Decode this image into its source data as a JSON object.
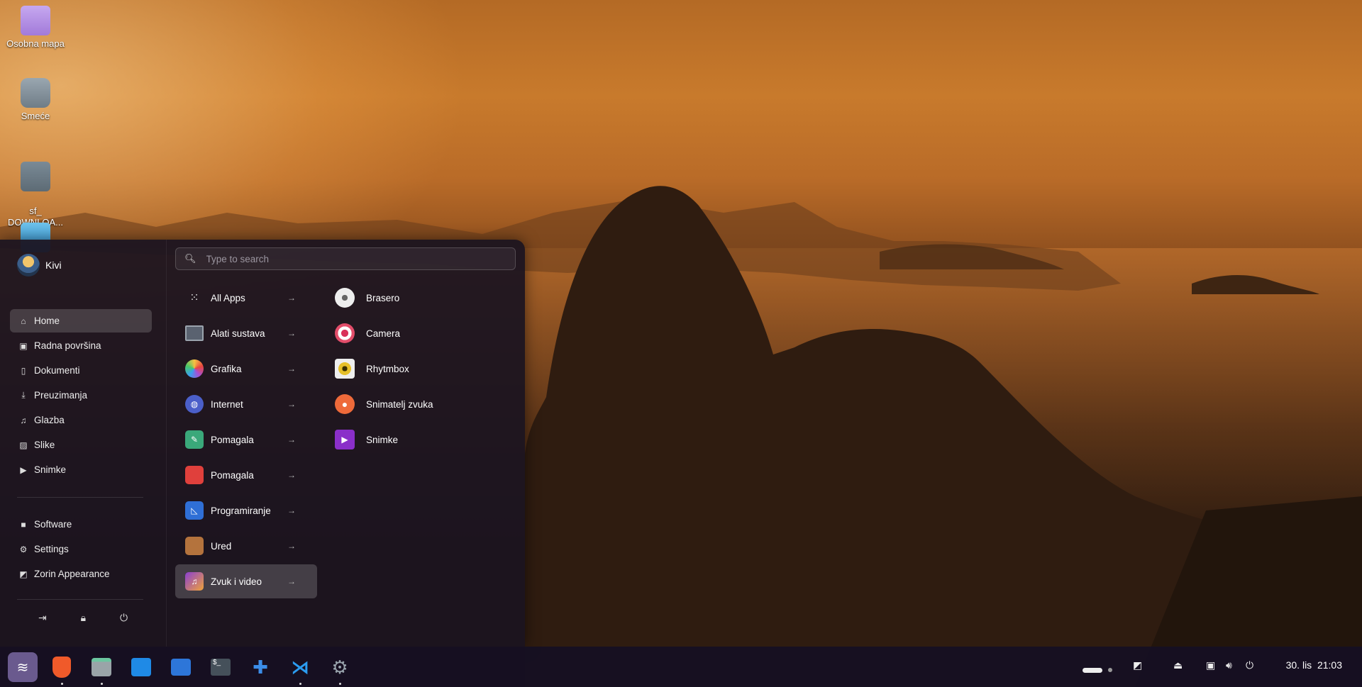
{
  "desktop": {
    "icons": [
      {
        "label": "Osobna mapa",
        "icon": "home-folder-icon"
      },
      {
        "label": "Smeće",
        "icon": "trash-icon"
      },
      {
        "label": "sf_\nDOWNLOA...",
        "icon": "drive-eject-icon"
      },
      {
        "label": "",
        "icon": "image-viewer-icon"
      }
    ]
  },
  "menu": {
    "user": {
      "name": "Kivi"
    },
    "nav": [
      {
        "label": "Home",
        "icon": "home-icon",
        "active": true
      },
      {
        "label": "Radna površina",
        "icon": "desktop-icon"
      },
      {
        "label": "Dokumenti",
        "icon": "document-icon"
      },
      {
        "label": "Preuzimanja",
        "icon": "download-icon"
      },
      {
        "label": "Glazba",
        "icon": "music-icon"
      },
      {
        "label": "Slike",
        "icon": "image-icon"
      },
      {
        "label": "Snimke",
        "icon": "video-icon"
      }
    ],
    "system": [
      {
        "label": "Software",
        "icon": "software-icon"
      },
      {
        "label": "Settings",
        "icon": "gear-icon"
      },
      {
        "label": "Zorin Appearance",
        "icon": "appearance-icon"
      }
    ],
    "power_buttons": [
      "logout-icon",
      "lock-icon",
      "power-icon"
    ],
    "search": {
      "placeholder": "Type to search"
    },
    "categories": [
      {
        "label": "All Apps",
        "icon": "grid-icon"
      },
      {
        "label": "Alati sustava",
        "icon": "system-tools-icon"
      },
      {
        "label": "Grafika",
        "icon": "graphics-icon"
      },
      {
        "label": "Internet",
        "icon": "internet-icon"
      },
      {
        "label": "Pomagala",
        "icon": "accessories-icon"
      },
      {
        "label": "Pomagala",
        "icon": "utilities-icon"
      },
      {
        "label": "Programiranje",
        "icon": "programming-icon"
      },
      {
        "label": "Ured",
        "icon": "office-icon"
      },
      {
        "label": "Zvuk i video",
        "icon": "sound-video-icon",
        "active": true
      }
    ],
    "apps": [
      {
        "label": "Brasero",
        "icon": "brasero-icon"
      },
      {
        "label": "Camera",
        "icon": "camera-icon"
      },
      {
        "label": "Rhytmbox",
        "icon": "rhythmbox-icon"
      },
      {
        "label": "Snimatelj zvuka",
        "icon": "microphone-icon"
      },
      {
        "label": "Snimke",
        "icon": "videos-icon"
      }
    ]
  },
  "taskbar": {
    "apps": [
      {
        "name": "zorin-menu-icon",
        "running": false
      },
      {
        "name": "brave-browser-icon",
        "running": true
      },
      {
        "name": "files-icon",
        "running": true
      },
      {
        "name": "software-store-icon",
        "running": false
      },
      {
        "name": "messages-icon",
        "running": false
      },
      {
        "name": "terminal-icon",
        "running": false
      },
      {
        "name": "extensions-icon",
        "running": false
      },
      {
        "name": "vscode-icon",
        "running": true
      },
      {
        "name": "settings-icon",
        "running": true
      }
    ],
    "clock": "30. lis  21:03"
  }
}
